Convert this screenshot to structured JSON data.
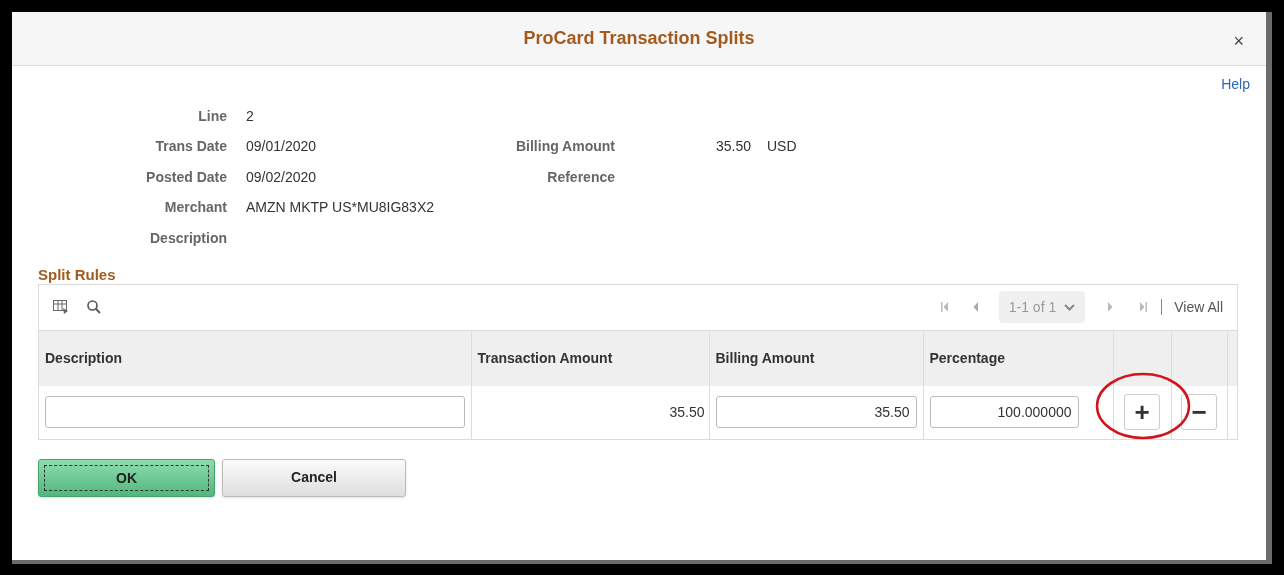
{
  "dialog": {
    "title": "ProCard Transaction Splits",
    "close": "×",
    "help": "Help"
  },
  "details_left": [
    {
      "label": "Line",
      "value": "2"
    },
    {
      "label": "Trans Date",
      "value": "09/01/2020"
    },
    {
      "label": "Posted Date",
      "value": "09/02/2020"
    },
    {
      "label": "Merchant",
      "value": "AMZN MKTP US*MU8IG83X2"
    },
    {
      "label": "Description"
    }
  ],
  "details_right": [
    {
      "label": "Billing Amount",
      "value": "35.50",
      "currency": "USD"
    },
    {
      "label": "Reference"
    }
  ],
  "split_rules": {
    "title": "Split Rules",
    "pager": "1-1 of 1",
    "view_all": "View All",
    "columns": [
      "Description",
      "Transaction Amount",
      "Billing Amount",
      "Percentage"
    ],
    "rows": [
      {
        "description": "",
        "transaction_amount": "35.50",
        "billing_amount": "35.50",
        "percentage": "100.000000",
        "add": "+",
        "remove": "−",
        "highlighted": true
      }
    ]
  },
  "buttons": [
    {
      "label": "OK",
      "kind": "primary"
    },
    {
      "label": "Cancel",
      "kind": "secondary"
    }
  ]
}
